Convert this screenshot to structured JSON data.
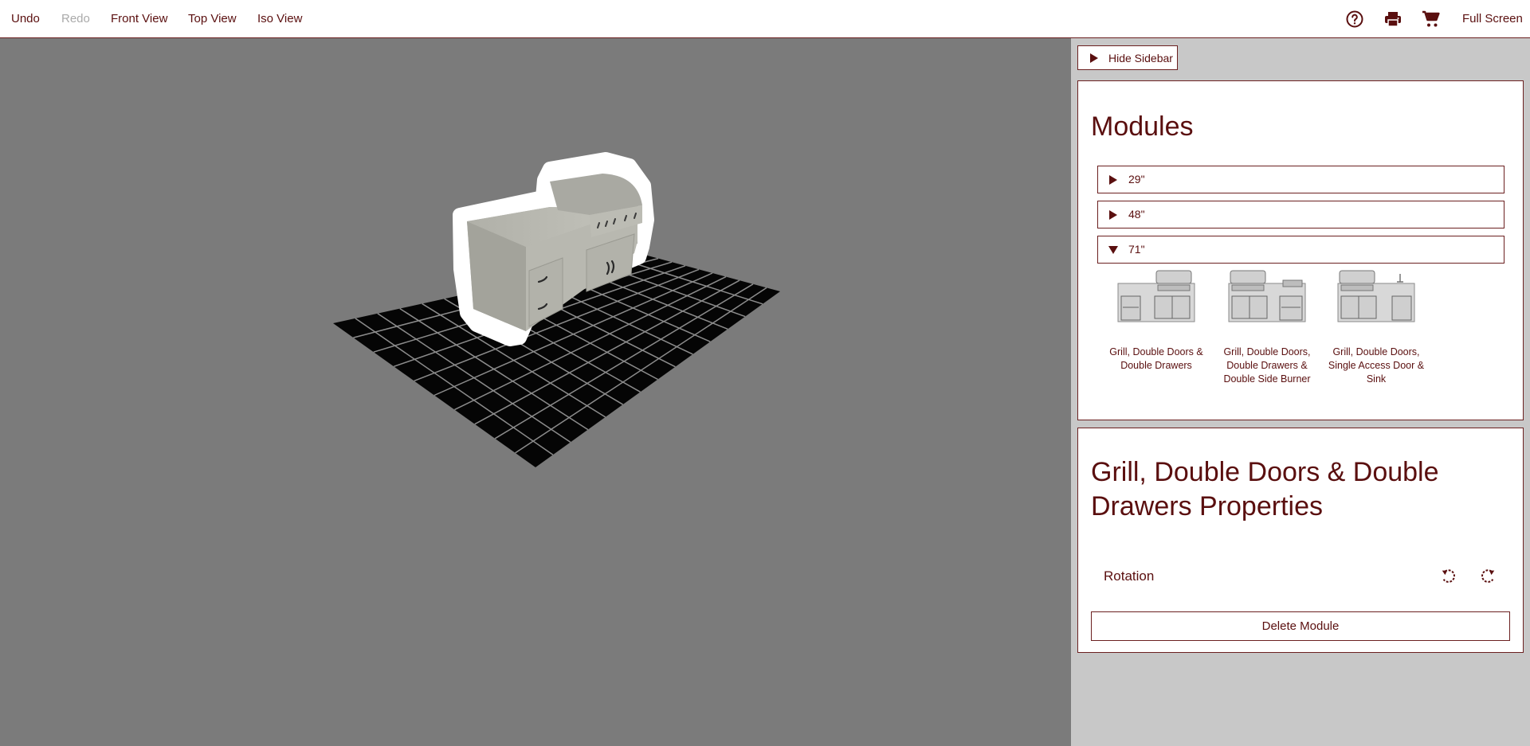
{
  "toolbar": {
    "undo": "Undo",
    "redo": "Redo",
    "front_view": "Front View",
    "top_view": "Top View",
    "iso_view": "Iso View",
    "full_screen": "Full Screen",
    "icons": [
      "help-icon",
      "print-icon",
      "cart-icon"
    ]
  },
  "sidebar": {
    "hide_label": "Hide Sidebar",
    "modules": {
      "title": "Modules",
      "sizes": [
        {
          "label": "29\"",
          "expanded": false
        },
        {
          "label": "48\"",
          "expanded": false
        },
        {
          "label": "71\"",
          "expanded": true
        }
      ],
      "items": [
        {
          "name": "Grill, Double Doors & Double Drawers"
        },
        {
          "name": "Grill, Double Doors, Double Drawers & Double Side Burner"
        },
        {
          "name": "Grill, Double Doors, Single Access Door & Sink"
        }
      ]
    },
    "properties": {
      "title": "Grill, Double Doors & Double Drawers Properties",
      "rotation_label": "Rotation",
      "delete_label": "Delete Module"
    }
  },
  "colors": {
    "accent": "#5a0f0f",
    "viewport_bg": "#7b7b7b",
    "sidebar_bg": "#c8c8c8",
    "floor_tile": "#000000",
    "grout": "#9a9a9a",
    "stucco": "#b5b5ad"
  }
}
